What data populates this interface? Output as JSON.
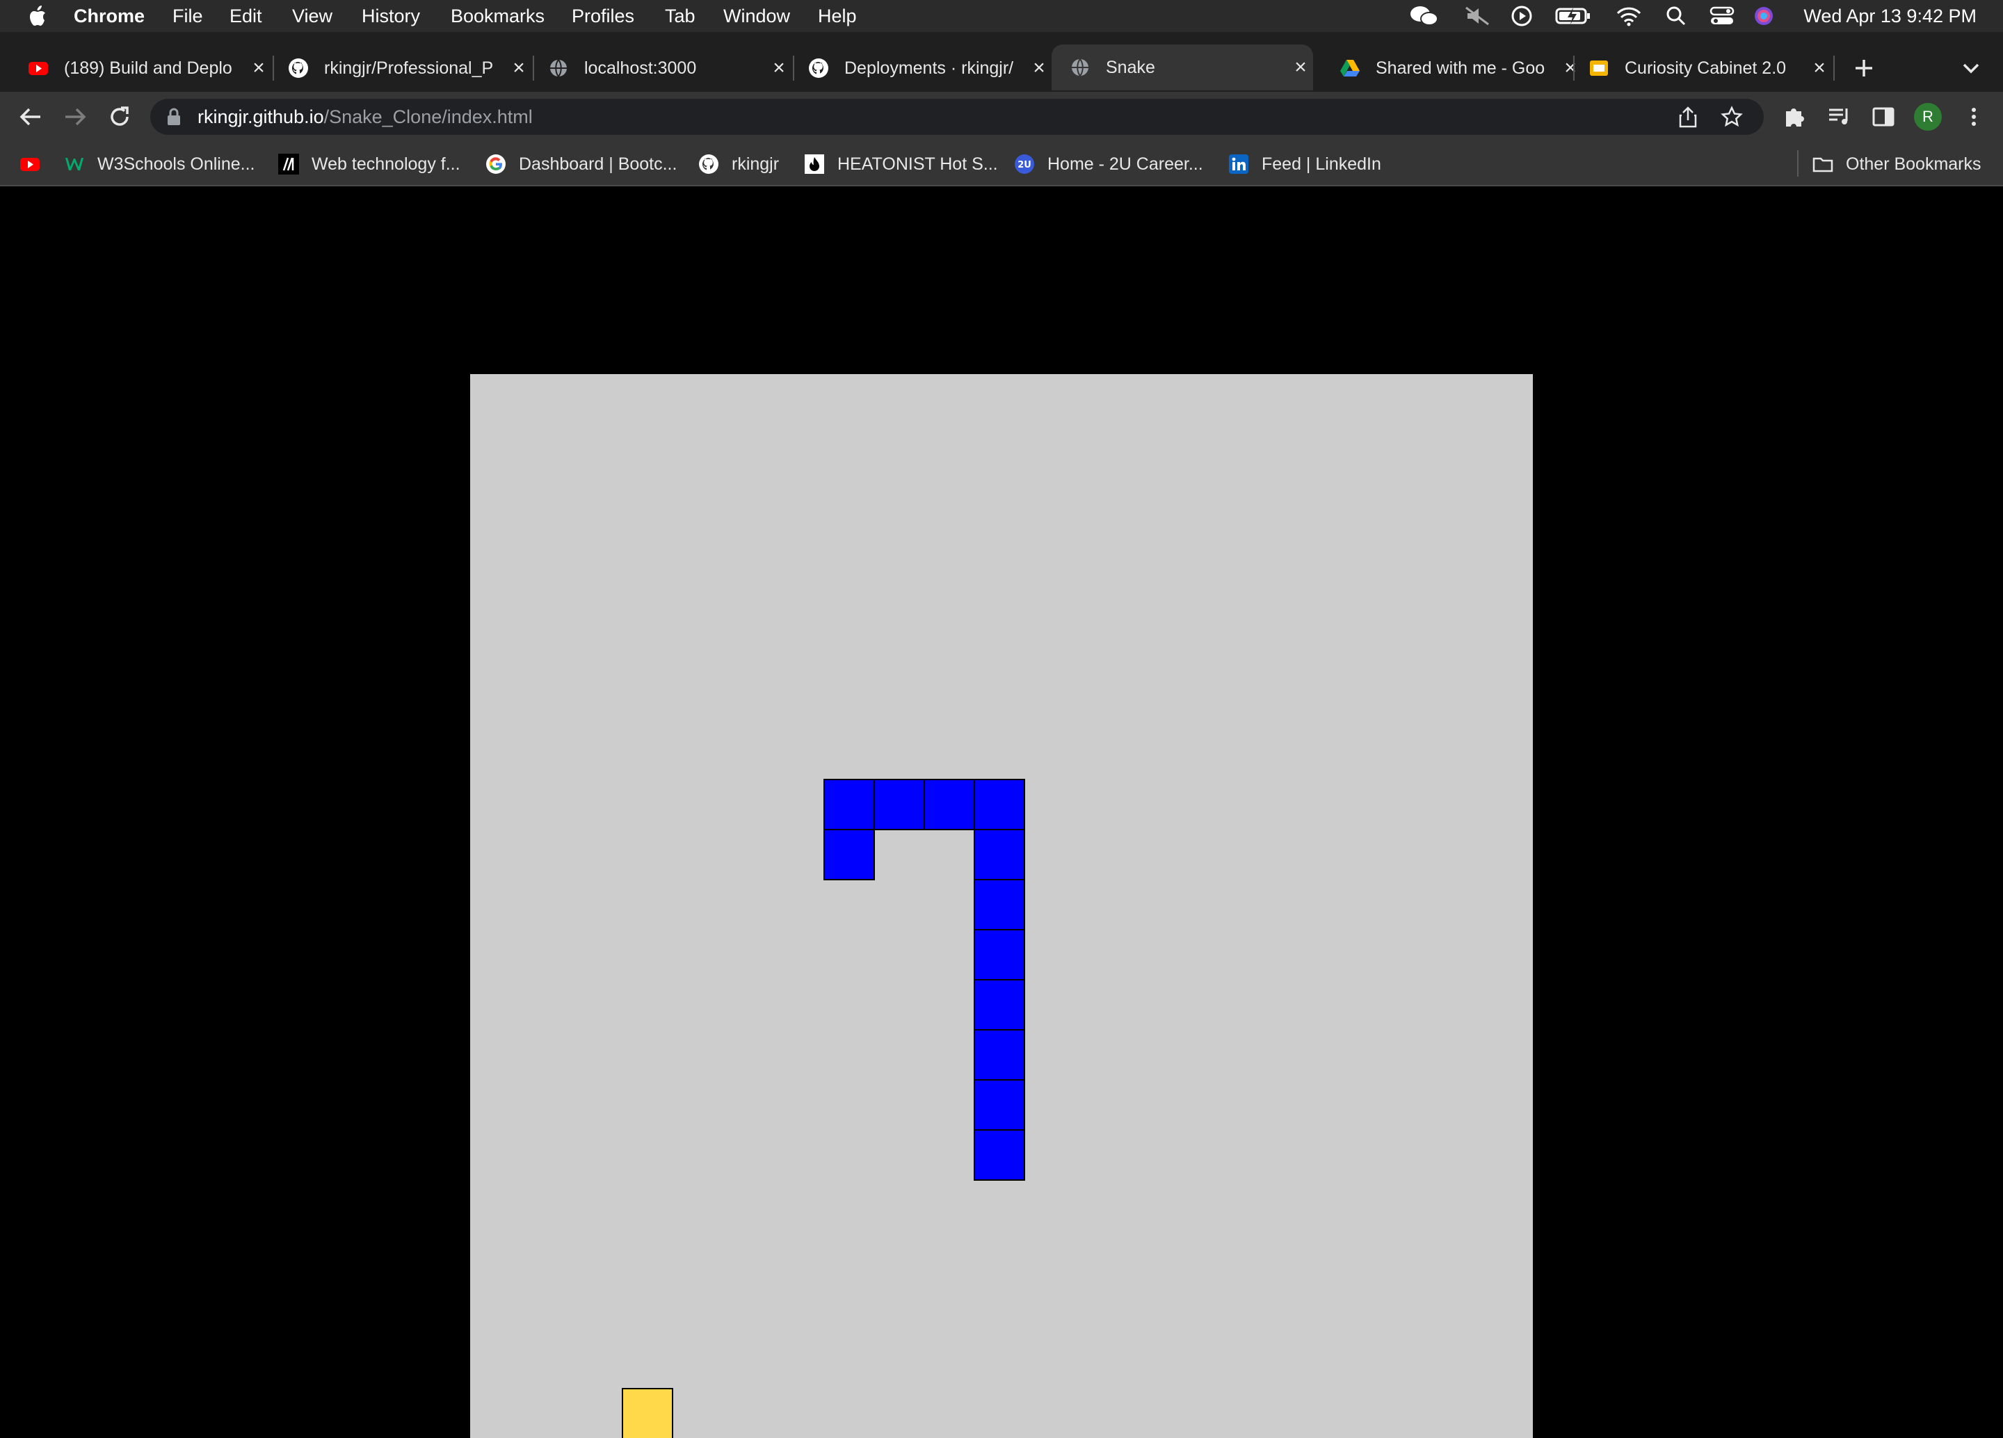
{
  "menubar": {
    "app_name": "Chrome",
    "items": [
      "File",
      "Edit",
      "View",
      "History",
      "Bookmarks",
      "Profiles",
      "Tab",
      "Window",
      "Help"
    ],
    "clock": "Wed Apr 13  9:42 PM"
  },
  "tabs": [
    {
      "title": "(189) Build and Deplo",
      "icon": "youtube-icon"
    },
    {
      "title": "rkingjr/Professional_P",
      "icon": "github-icon"
    },
    {
      "title": "localhost:3000",
      "icon": "globe-icon"
    },
    {
      "title": "Deployments · rkingjr/",
      "icon": "github-icon"
    },
    {
      "title": "Snake",
      "icon": "globe-icon",
      "active": true
    },
    {
      "title": "Shared with me - Goo",
      "icon": "google-drive-icon"
    },
    {
      "title": "Curiosity Cabinet 2.0",
      "icon": "slides-icon"
    }
  ],
  "omnibox": {
    "host": "rkingjr.github.io",
    "path": "/Snake_Clone/index.html"
  },
  "profile_initial": "R",
  "bookmarks": [
    {
      "label": "",
      "icon": "youtube-icon"
    },
    {
      "label": "W3Schools Online...",
      "icon": "w3schools-icon"
    },
    {
      "label": "Web technology f...",
      "icon": "mdn-icon"
    },
    {
      "label": "Dashboard | Bootc...",
      "icon": "google-icon"
    },
    {
      "label": "rkingjr",
      "icon": "github-icon"
    },
    {
      "label": "HEATONIST Hot S...",
      "icon": "heatonist-icon"
    },
    {
      "label": "Home - 2U Career...",
      "icon": "2u-icon"
    },
    {
      "label": "Feed | LinkedIn",
      "icon": "linkedin-icon"
    }
  ],
  "other_bookmarks": "Other Bookmarks",
  "colors": {
    "board": "#cdcdcd",
    "snake": "#0000ff",
    "food": "#ffd94a"
  }
}
